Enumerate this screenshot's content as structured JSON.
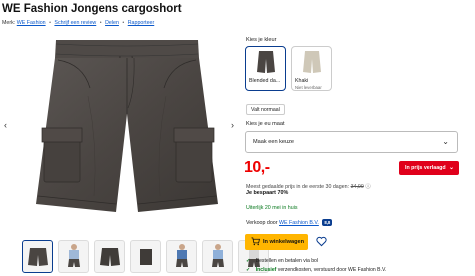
{
  "product": {
    "title": "WE Fashion Jongens cargoshort",
    "brand_prefix": "Merk:",
    "brand": "WE Fashion",
    "review_link": "Schrijf een review",
    "share_link": "Delen",
    "report_link": "Rapporteer"
  },
  "gallery": {
    "thumb_count": 7,
    "active_index": 0
  },
  "color": {
    "label": "Kies je kleur",
    "options": [
      {
        "label": "Blended da...",
        "sub": "",
        "selected": true
      },
      {
        "label": "Khaki",
        "sub": "Niet leverbaar",
        "selected": false
      }
    ]
  },
  "size": {
    "fit_button": "Valt normaal",
    "label": "Kies je eu maat",
    "select_value": "Maak een keuze"
  },
  "pricing": {
    "price": "10,-",
    "promo_label": "In prijs verlaagd",
    "lowest_prefix": "Meest gedaalde prijs in de eerste 30 dagen:",
    "old_price": "34,99",
    "savings": "Je bespaart 70%"
  },
  "stock": "Uiterlijk 20 mei in huis",
  "seller": {
    "prefix": "Verkoop door",
    "name": "WE Fashion B.V.",
    "score": "8,8"
  },
  "cart": {
    "label": "In winkelwagen"
  },
  "checks": {
    "line1": "Bestellen en betalen via bol",
    "line2_highlight": "Inclusief",
    "line2_rest": "verzendkosten, verstuurd door WE Fashion B.V."
  },
  "colors": {
    "accent_blue": "#0a3d8f",
    "price_red": "#e00000",
    "cart_yellow": "#ffb500",
    "stock_green": "#0a7a1f"
  }
}
